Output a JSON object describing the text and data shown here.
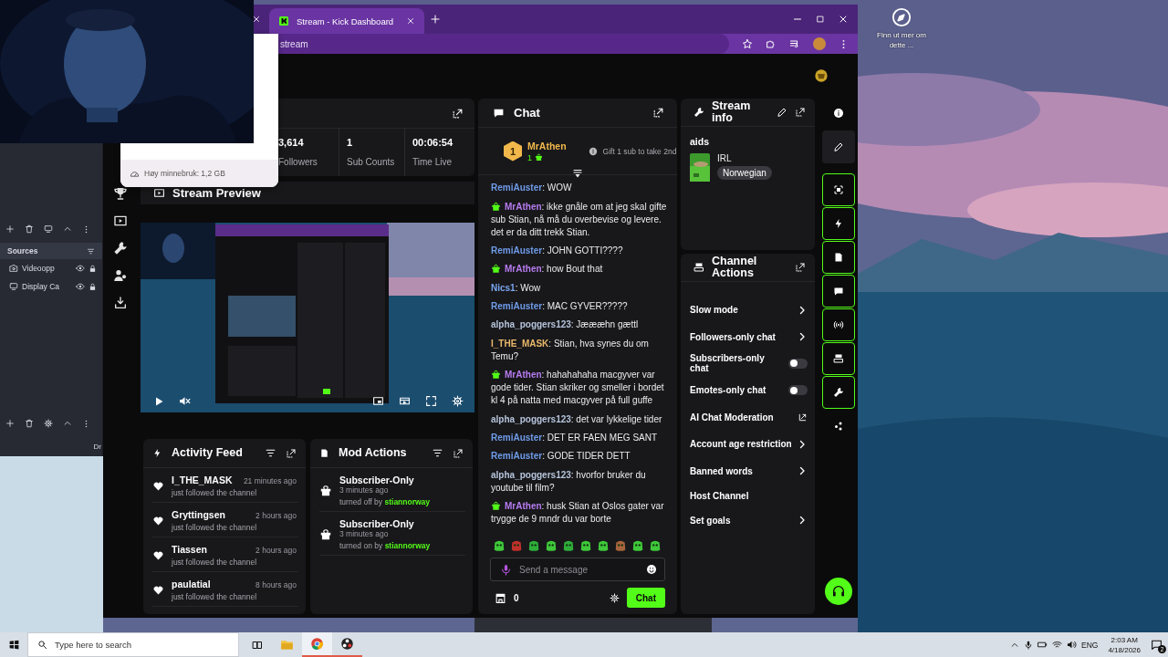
{
  "desktop": {
    "shortcut_label": "Finn ut mer om dette ..."
  },
  "obs": {
    "sources_title": "Sources",
    "sources": [
      {
        "name": "Videoopp",
        "kind": "camera"
      },
      {
        "name": "Display Ca",
        "kind": "display"
      }
    ],
    "edge_text": "Dr"
  },
  "browser": {
    "tabs": [
      {
        "title": "Stream - Kick Dashboard",
        "selected": true
      }
    ],
    "address": "stream"
  },
  "memory_popup": {
    "text": "Høy minnebruk: 1,2 GB"
  },
  "stats": [
    {
      "value": "3,614",
      "label": "Followers"
    },
    {
      "value": "1",
      "label": "Sub Counts"
    },
    {
      "value": "00:06:54",
      "label": "Time Live"
    }
  ],
  "preview": {
    "title": "Stream Preview",
    "muted": true
  },
  "activity_feed": {
    "title": "Activity Feed",
    "items": [
      {
        "name": "I_THE_MASK",
        "time": "21 minutes ago",
        "detail": "just followed the channel"
      },
      {
        "name": "Gryttingsen",
        "time": "2 hours ago",
        "detail": "just followed the channel"
      },
      {
        "name": "Tiassen",
        "time": "2 hours ago",
        "detail": "just followed the channel"
      },
      {
        "name": "paulatial",
        "time": "8 hours ago",
        "detail": "just followed the channel"
      }
    ]
  },
  "mod_actions": {
    "title": "Mod Actions",
    "items": [
      {
        "title": "Subscriber-Only",
        "time": "3 minutes ago",
        "action": "turned off by",
        "user": "stiannorway"
      },
      {
        "title": "Subscriber-Only",
        "time": "3 minutes ago",
        "action": "turned on by",
        "user": "stiannorway"
      }
    ]
  },
  "chat": {
    "title": "Chat",
    "leader": {
      "rank": "1",
      "name": "MrAthen",
      "gifts": "1"
    },
    "gift_prompt": "Gift 1 sub to take 2nd",
    "messages": [
      {
        "user": "RemiAuster",
        "color": "#6f9be8",
        "sub_badge": false,
        "text": ": WOW"
      },
      {
        "user": "MrAthen",
        "color": "#b77cf0",
        "sub_badge": true,
        "text": ": ikke gnåle om at jeg skal gifte sub Stian, nå må du overbevise og levere. det er da ditt trekk Stian."
      },
      {
        "user": "RemiAuster",
        "color": "#6f9be8",
        "sub_badge": false,
        "text": ": JOHN GOTTI????"
      },
      {
        "user": "MrAthen",
        "color": "#b77cf0",
        "sub_badge": true,
        "text": ": how Bout that"
      },
      {
        "user": "Nics1",
        "color": "#7aa6f0",
        "sub_badge": false,
        "text": ": Wow"
      },
      {
        "user": "RemiAuster",
        "color": "#6f9be8",
        "sub_badge": false,
        "text": ": MAC GYVER?????"
      },
      {
        "user": "alpha_poggers123",
        "color": "#b5c3da",
        "sub_badge": false,
        "text": ": Jæææhn gættl"
      },
      {
        "user": "I_THE_MASK",
        "color": "#e8b86a",
        "sub_badge": false,
        "text": ": Stian, hva synes du om Temu?"
      },
      {
        "user": "MrAthen",
        "color": "#b77cf0",
        "sub_badge": true,
        "text": ": hahahahaha macgyver var gode tider. Stian skriker og smeller i bordet kl 4 på natta med macgyver på full guffe"
      },
      {
        "user": "alpha_poggers123",
        "color": "#b5c3da",
        "sub_badge": false,
        "text": ": det var lykkelige tider"
      },
      {
        "user": "RemiAuster",
        "color": "#6f9be8",
        "sub_badge": false,
        "text": ": DET ER FAEN MEG SANT"
      },
      {
        "user": "RemiAuster",
        "color": "#6f9be8",
        "sub_badge": false,
        "text": ": GODE TIDER DETT"
      },
      {
        "user": "alpha_poggers123",
        "color": "#b5c3da",
        "sub_badge": false,
        "text": ": hvorfor bruker du youtube til film?"
      },
      {
        "user": "MrAthen",
        "color": "#b77cf0",
        "sub_badge": true,
        "text": ": husk Stian at Oslos gater var trygge de 9 mndr du var borte"
      }
    ],
    "input": {
      "placeholder": "Send a message"
    },
    "points": "0",
    "send_label": "Chat"
  },
  "stream_info": {
    "title": "Stream info",
    "stream_title": "aids",
    "category": "IRL",
    "language": "Norwegian"
  },
  "channel_actions": {
    "title": "Channel Actions",
    "items": [
      {
        "label": "Slow mode",
        "kind": "arrow"
      },
      {
        "label": "Followers-only chat",
        "kind": "arrow"
      },
      {
        "label": "Subscribers-only chat",
        "kind": "toggle",
        "on": false
      },
      {
        "label": "Emotes-only chat",
        "kind": "toggle",
        "on": false
      },
      {
        "label": "AI Chat Moderation",
        "kind": "external"
      },
      {
        "label": "Account age restriction",
        "kind": "arrow"
      },
      {
        "label": "Banned words",
        "kind": "arrow"
      },
      {
        "label": "Host Channel",
        "kind": "plain"
      },
      {
        "label": "Set goals",
        "kind": "arrow"
      }
    ]
  },
  "rail": [
    {
      "kind": "info",
      "active": false
    },
    {
      "kind": "edit",
      "active": false
    },
    {
      "kind": "focus",
      "active": true
    },
    {
      "kind": "bolt",
      "active": true
    },
    {
      "kind": "doc",
      "active": true
    },
    {
      "kind": "chat",
      "active": true
    },
    {
      "kind": "broadcast",
      "active": true
    },
    {
      "kind": "layout",
      "active": true
    },
    {
      "kind": "wrench",
      "active": true
    },
    {
      "kind": "cluster",
      "active": false
    }
  ],
  "taskbar": {
    "search_placeholder": "Type here to search",
    "language": "ENG",
    "time": "2:03 AM",
    "date": "4/18/2026",
    "notifications": "2"
  }
}
